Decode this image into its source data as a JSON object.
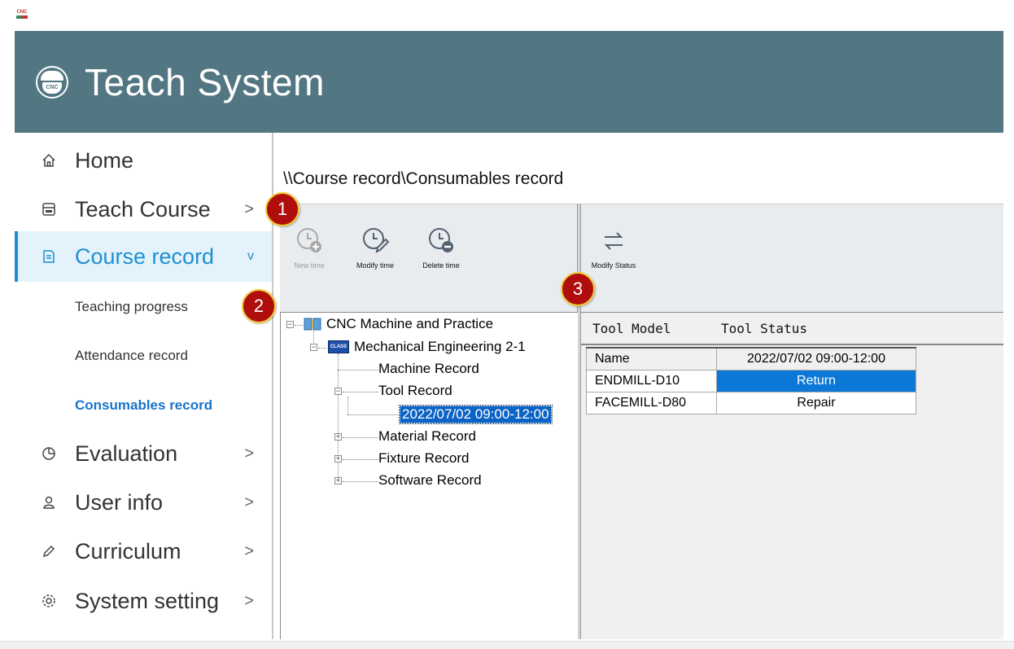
{
  "header": {
    "title": "Teach System",
    "logo_text": "RomAn CNC",
    "tiny_logo_text": "CNC"
  },
  "sidebar": {
    "items": [
      {
        "label": "Home",
        "icon": "home-icon"
      },
      {
        "label": "Teach Course",
        "icon": "cnc-panel-icon",
        "arrow": ">"
      },
      {
        "label": "Course record",
        "icon": "document-icon",
        "arrow": "v"
      },
      {
        "label": "Evaluation",
        "icon": "pie-chart-icon",
        "arrow": ">"
      },
      {
        "label": "User info",
        "icon": "user-icon",
        "arrow": ">"
      },
      {
        "label": "Curriculum",
        "icon": "pencil-icon",
        "arrow": ">"
      },
      {
        "label": "System setting",
        "icon": "gear-icon",
        "arrow": ">"
      }
    ],
    "sub_items": [
      {
        "label": "Teaching progress"
      },
      {
        "label": "Attendance record"
      },
      {
        "label": "Consumables record"
      }
    ]
  },
  "breadcrumb": "\\\\Course record\\Consumables record",
  "toolbar_left": {
    "new_time": "New time",
    "modify_time": "Modify time",
    "delete_time": "Delete time"
  },
  "toolbar_right": {
    "modify_status": "Modify Status"
  },
  "tree": {
    "root": "CNC Machine and Practice",
    "class": "Mechanical Engineering 2-1",
    "class_icon_text": "CLASS",
    "machine_record": "Machine Record",
    "tool_record": "Tool Record",
    "selected_time": "2022/07/02 09:00-12:00",
    "material_record": "Material Record",
    "fixture_record": "Fixture Record",
    "software_record": "Software Record"
  },
  "grid": {
    "columns": [
      "Tool Model",
      "Tool Status"
    ],
    "header_row": [
      "Name",
      "2022/07/02 09:00-12:00"
    ],
    "rows": [
      [
        "ENDMILL-D10",
        "Return"
      ],
      [
        "FACEMILL-D80",
        "Repair"
      ]
    ]
  },
  "badges": [
    "1",
    "2",
    "3"
  ],
  "colors": {
    "header_bg": "#537683",
    "accent": "#1e8fd3",
    "selection": "#0b78d7",
    "badge": "#b00d0d"
  }
}
